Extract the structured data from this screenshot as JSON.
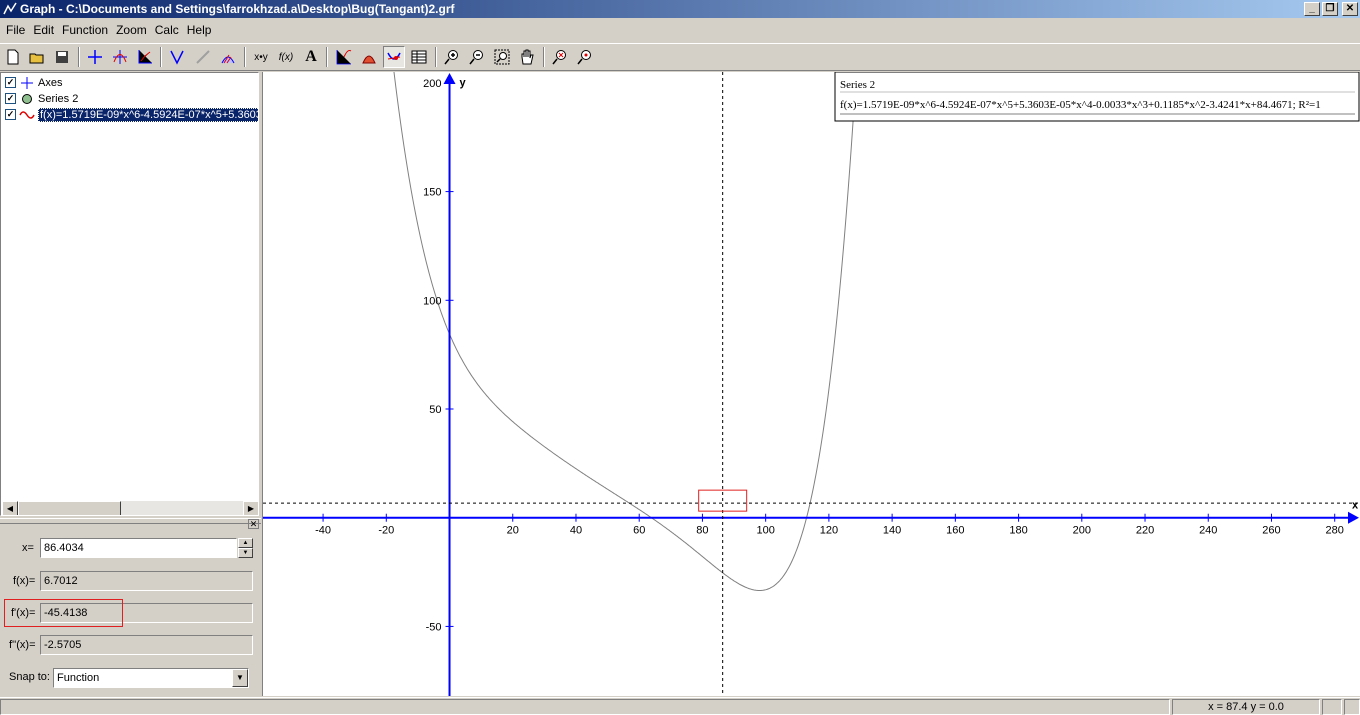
{
  "window": {
    "title": "Graph - C:\\Documents and Settings\\farrokhzad.a\\Desktop\\Bug(Tangant)2.grf"
  },
  "menu": [
    "File",
    "Edit",
    "Function",
    "Zoom",
    "Calc",
    "Help"
  ],
  "toolbar": {
    "buttons": [
      "new-icon",
      "open-icon",
      "save-icon",
      "axes-icon",
      "insert-function-icon",
      "insert-series-icon",
      "tangent-icon",
      "relation-icon",
      "shading-icon",
      "point-series-icon",
      "f-of-x-icon",
      "label-icon",
      "trendline-icon",
      "area-icon",
      "evaluate-icon",
      "table-icon",
      "zoom-in-icon",
      "zoom-out-icon",
      "zoom-square-icon",
      "pan-icon",
      "zoom-standard-icon",
      "zoom-fit-icon"
    ],
    "pressed": "evaluate-icon",
    "insert_series_label": "x•y",
    "fx_label": "f(x)",
    "text_label": "A"
  },
  "tree": {
    "items": [
      {
        "label": "Axes",
        "checked": true,
        "icon": "axes-icon"
      },
      {
        "label": "Series 2",
        "checked": true,
        "icon": "series-marker-icon"
      },
      {
        "label": "f(x)=1.5719E-09*x^6-4.5924E-07*x^5+5.3603E-05*x^4-0.0033*x^3+0.1185*x^2-3.4241*x+84.4671",
        "checked": true,
        "icon": "function-curve-icon",
        "selected": true
      }
    ]
  },
  "eval": {
    "x_label": "x=",
    "x_value": "86.4034",
    "fx_label": "f(x)=",
    "fx_value": "6.7012",
    "dfx_label": "f'(x)=",
    "dfx_value": "-45.4138",
    "ddfx_label": "f''(x)=",
    "ddfx_value": "-2.5705",
    "snap_label": "Snap to:",
    "snap_value": "Function"
  },
  "legend": {
    "title": "Series 2",
    "entry": "f(x)=1.5719E-09*x^6-4.5924E-07*x^5+5.3603E-05*x^4-0.0033*x^3+0.1185*x^2-3.4241*x+84.4671; R²=1"
  },
  "graph": {
    "x_axis_label": "x",
    "y_axis_label": "y",
    "xlim": [
      -59,
      288
    ],
    "ylim": [
      -82,
      205
    ],
    "x_ticks": [
      -40,
      -20,
      20,
      40,
      60,
      80,
      100,
      120,
      140,
      160,
      180,
      200,
      220,
      240,
      260,
      280
    ],
    "y_ticks": [
      -50,
      50,
      100,
      150,
      200
    ],
    "cursor_x": 86.4034,
    "cursor_y": 6.7012,
    "axis_color": "#0000ff",
    "curve_color": "#808080",
    "highlight_color": "#e02020"
  },
  "chart_data": {
    "type": "line",
    "series": [
      {
        "name": "Series 2",
        "coefficients": [
          84.4671,
          -3.4241,
          0.1185,
          -0.0033,
          5.3603e-05,
          -4.5924e-07,
          1.5719e-09
        ]
      }
    ],
    "xlabel": "x",
    "ylabel": "y",
    "xlim": [
      -59,
      288
    ],
    "ylim": [
      -82,
      205
    ],
    "grid": false
  },
  "status": {
    "coords": "x = 87.4    y = 0.0"
  }
}
